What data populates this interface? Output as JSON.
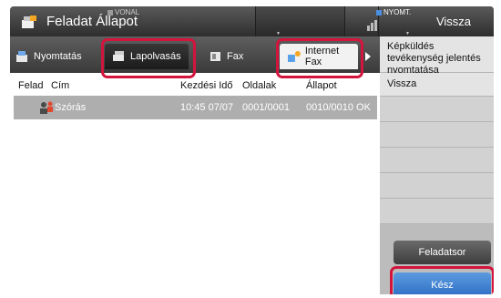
{
  "header": {
    "title": "Feladat Állapot",
    "status": {
      "line_label": "VONAL",
      "print_label": "NYOMT."
    },
    "back_label": "Vissza"
  },
  "tabs": [
    {
      "label": "Nyomtatás",
      "icon": "printer-icon",
      "active": false
    },
    {
      "label": "Lapolvasás",
      "icon": "scanner-icon",
      "active": true
    },
    {
      "label": "Fax",
      "icon": "fax-icon",
      "active": false
    },
    {
      "label": "Internet Fax",
      "icon": "internet-fax-icon",
      "active": false
    }
  ],
  "table": {
    "columns": [
      "Felad",
      "Cím",
      "Kezdési Idő",
      "Oldalak",
      "Állapot"
    ],
    "rows": [
      {
        "title": "Szórás",
        "start_time": "10:45 07/07",
        "pages": "0001/0001",
        "status": "0010/0010 OK",
        "icon": "broadcast-users-icon"
      }
    ]
  },
  "sidebar": {
    "items": [
      "Képküldés tevékenység jelentés nyomtatása",
      "Vissza"
    ],
    "job_queue_label": "Feladatsor",
    "done_label": "Kész"
  },
  "colors": {
    "highlight": "#d3143c",
    "done_button": "#3a7fd5",
    "line_indicator": "#9a9a9a",
    "print_indicator": "#4a8fe0"
  }
}
